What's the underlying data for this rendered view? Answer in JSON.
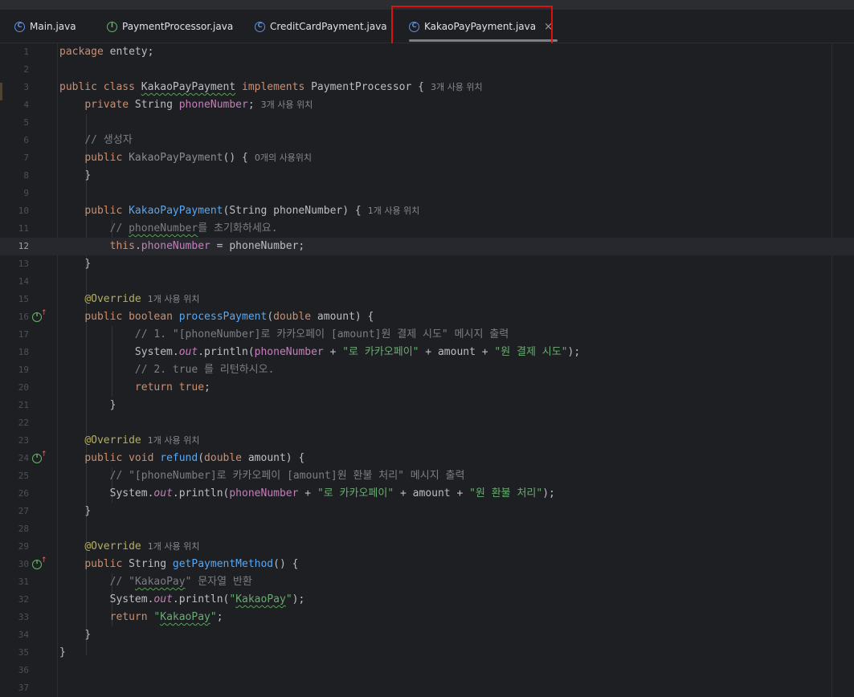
{
  "tabs": [
    {
      "label": "Main.java",
      "icon": "class-icon"
    },
    {
      "label": "PaymentProcessor.java",
      "icon": "interface-icon"
    },
    {
      "label": "CreditCardPayment.java",
      "icon": "class-icon"
    },
    {
      "label": "KakaoPayPayment.java",
      "icon": "class-icon",
      "active": true,
      "close": "×"
    }
  ],
  "usages": {
    "three": "3개 사용 위치",
    "zero": "0개의 사용위치",
    "one": "1개 사용 위치"
  },
  "code": {
    "l1": [
      "package",
      " entety;"
    ],
    "l3": [
      "public",
      "class",
      "KakaoPayPayment",
      "implements",
      "PaymentProcessor",
      " {"
    ],
    "l4": [
      "private",
      " String ",
      "phoneNumber",
      ";"
    ],
    "l6": "// 생성자",
    "l7": [
      "public",
      "KakaoPayPayment",
      "() {"
    ],
    "l8": "}",
    "l10": [
      "public",
      "KakaoPayPayment",
      "(String phoneNumber) {"
    ],
    "l11": [
      "// ",
      "phoneNumber",
      "를 초기화하세요."
    ],
    "l12": [
      "this",
      ".",
      "phoneNumber",
      " = phoneNumber;"
    ],
    "l13": "}",
    "l15": "@Override",
    "l16": [
      "public",
      "boolean",
      "processPayment",
      "(",
      "double",
      " amount) {"
    ],
    "l17": "// 1. \"[phoneNumber]로 카카오페이 [amount]원 결제 시도\" 메시지 출력",
    "l18": [
      "System.",
      "out",
      ".println(",
      "phoneNumber",
      " + ",
      "\"로 카카오페이\"",
      " + amount + ",
      "\"원 결제 시도\"",
      ");"
    ],
    "l19": "// 2. true 를 리턴하시오.",
    "l20": [
      "return",
      "true",
      ";"
    ],
    "l21": "}",
    "l23": "@Override",
    "l24": [
      "public",
      "void",
      "refund",
      "(",
      "double",
      " amount) {"
    ],
    "l25": "// \"[phoneNumber]로 카카오페이 [amount]원 환불 처리\" 메시지 출력",
    "l26": [
      "System.",
      "out",
      ".println(",
      "phoneNumber",
      " + ",
      "\"로 카카오페이\"",
      " + amount + ",
      "\"원 환불 처리\"",
      ");"
    ],
    "l27": "}",
    "l29": "@Override",
    "l30": [
      "public",
      " String ",
      "getPaymentMethod",
      "() {"
    ],
    "l31": [
      "// \"",
      "KakaoPay",
      "\" 문자열 반환"
    ],
    "l32": [
      "System.",
      "out",
      ".println(",
      "\"",
      "KakaoPay",
      "\"",
      ");"
    ],
    "l33": [
      "return",
      "\"",
      "KakaoPay",
      "\"",
      ";"
    ],
    "l34": "}",
    "l35": "}"
  },
  "line_numbers": [
    "1",
    "2",
    "3",
    "4",
    "5",
    "6",
    "7",
    "8",
    "9",
    "10",
    "11",
    "12",
    "13",
    "14",
    "15",
    "16",
    "17",
    "18",
    "19",
    "20",
    "21",
    "22",
    "23",
    "24",
    "25",
    "26",
    "27",
    "28",
    "29",
    "30",
    "31",
    "32",
    "33",
    "34",
    "35",
    "36",
    "37"
  ],
  "current_line": "12",
  "colors": {
    "background": "#1e1f22",
    "keyword": "#cf8e6d",
    "field": "#c77dbb",
    "method": "#56a8f5",
    "string": "#6aab73",
    "annotation": "#b3ae60",
    "comment": "#7a7e85",
    "highlight_box": "#e01010"
  }
}
